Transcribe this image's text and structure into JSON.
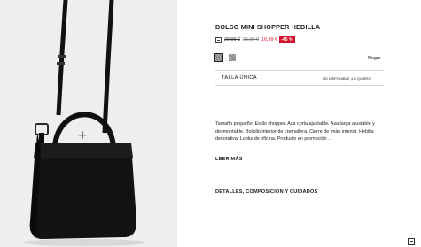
{
  "product": {
    "title": "BOLSO MINI SHOPPER HEBILLA",
    "price_original": "29,99 €",
    "price_previous": "25,99 €",
    "price_current": "16,99 €",
    "discount": "-45 %",
    "price_icon": "price-info-icon"
  },
  "colors": {
    "swatches": [
      "swatch-1",
      "swatch-2"
    ],
    "selected_name": "Negro"
  },
  "size": {
    "label": "TALLA ÚNICA",
    "status": "NO DISPONIBLE ¡LO QUIERO!"
  },
  "description": {
    "text": "Tamaño pequeño. Estilo shopper. Asa corta ajustable. Asa larga ajustable y desmontable. Bolsillo interior de cremallera. Cierre de imán interior. Hebilla decorativa. Looks de oficina. Producto en promoción ...",
    "read_more": "LEER MÁS"
  },
  "details": {
    "label": "DETALLES, COMPOSICIÓN Y CUIDADOS"
  },
  "gallery": {
    "zoom_icon": "+",
    "background": "#eeeeee"
  },
  "chat": {
    "icon": "chat-icon"
  }
}
